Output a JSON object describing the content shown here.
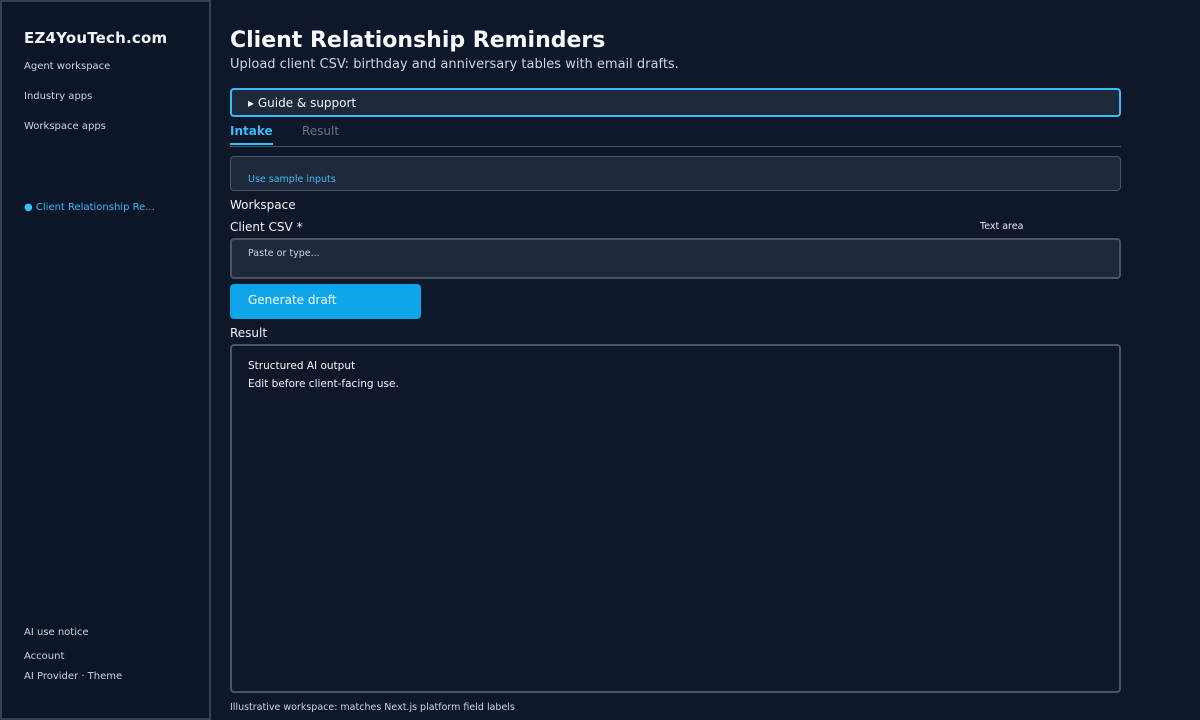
{
  "sidebar": {
    "brand": "EZ4YouTech.com",
    "nav": [
      {
        "label": "Agent workspace"
      },
      {
        "label": "Industry apps"
      },
      {
        "label": "Workspace apps"
      }
    ],
    "active_item": "● Client Relationship Re...",
    "footer": [
      {
        "label": "AI use notice"
      },
      {
        "label": "Account"
      },
      {
        "label": "AI Provider · Theme"
      }
    ]
  },
  "main": {
    "title": "Client Relationship Reminders",
    "subtitle": "Upload client CSV: birthday and anniversary tables with email drafts.",
    "guide_label": "▸ Guide & support",
    "tabs": [
      {
        "label": "Intake",
        "active": true
      },
      {
        "label": "Result",
        "active": false
      }
    ],
    "sample_link": "Use sample inputs",
    "workspace_label": "Workspace",
    "field": {
      "label": "Client CSV *",
      "type_label": "Text area",
      "placeholder": "Paste or type..."
    },
    "generate_button": "Generate draft",
    "result_label": "Result",
    "result_lines": [
      "Structured AI output",
      "Edit before client-facing use."
    ],
    "footer_note": "Illustrative workspace: matches Next.js platform field labels"
  },
  "colors": {
    "background": "#0f172a",
    "sidebar": "#0b1628",
    "accent": "#38bdf8",
    "button": "#0ea5e9",
    "panel": "#1e293b"
  }
}
